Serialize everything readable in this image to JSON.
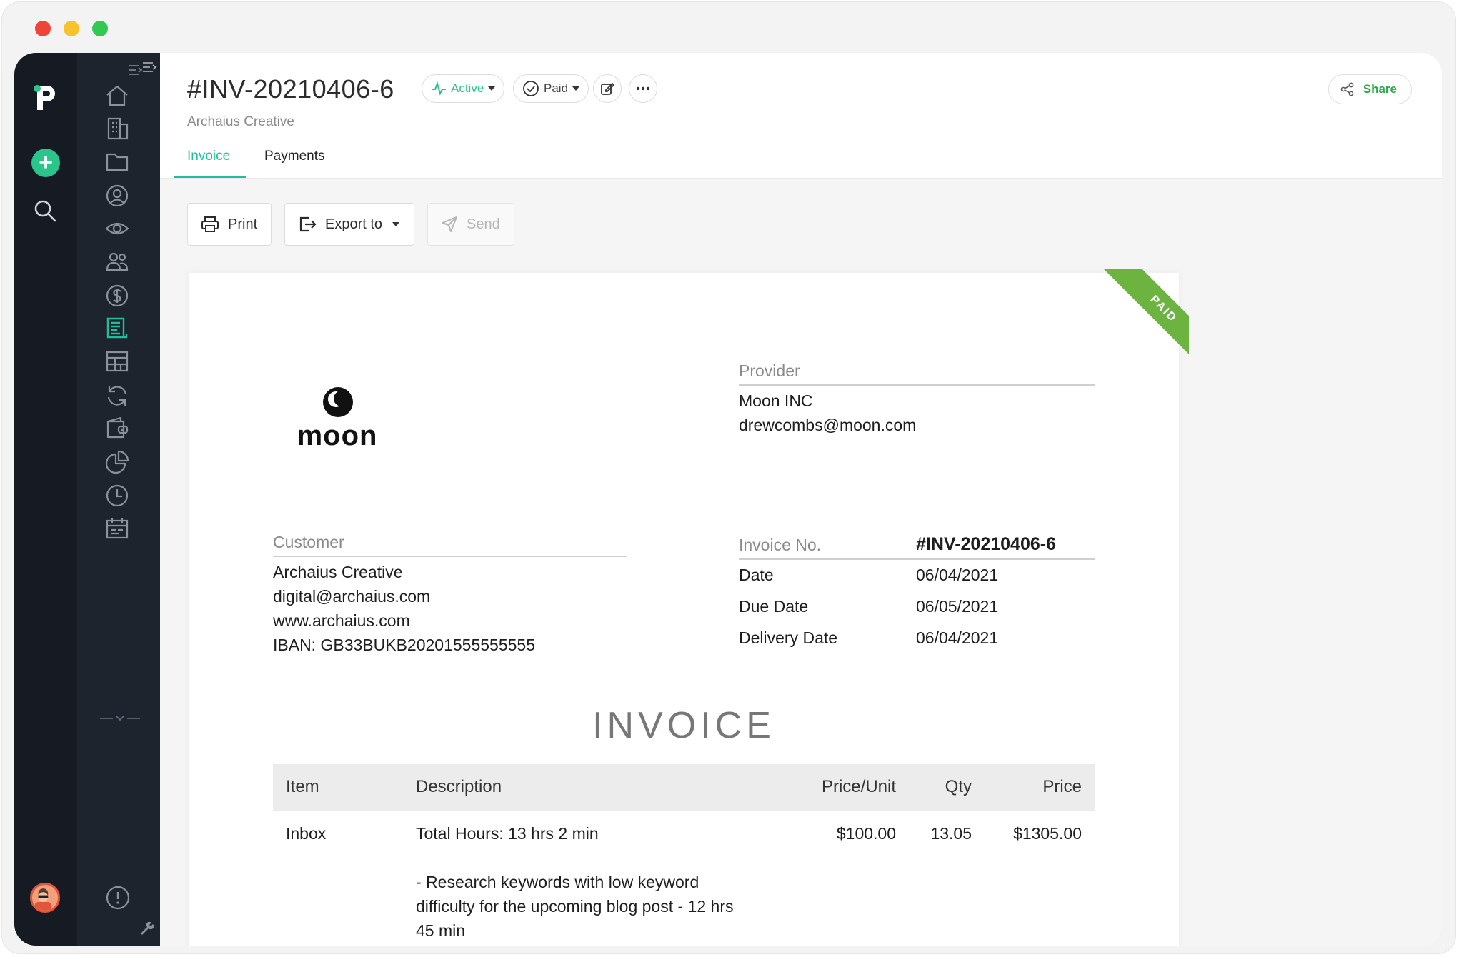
{
  "window": {
    "dots": [
      "#f0433a",
      "#f7c32b",
      "#2fc953"
    ]
  },
  "header": {
    "invoice_id": "#INV-20210406-6",
    "status_label": "Active",
    "payment_label": "Paid",
    "client_name": "Archaius Creative",
    "share_label": "Share",
    "tabs": [
      {
        "label": "Invoice",
        "active": true
      },
      {
        "label": "Payments",
        "active": false
      }
    ]
  },
  "toolbar": {
    "print_label": "Print",
    "export_label": "Export to",
    "send_label": "Send"
  },
  "document": {
    "ribbon": "PAID",
    "logo_text": "moon",
    "provider": {
      "label": "Provider",
      "name": "Moon INC",
      "email": "drewcombs@moon.com"
    },
    "customer": {
      "label": "Customer",
      "name": "Archaius Creative",
      "email": "digital@archaius.com",
      "website": "www.archaius.com",
      "iban": "IBAN: GB33BUKB20201555555555"
    },
    "meta": {
      "invoice_no_label": "Invoice No.",
      "invoice_no": "#INV-20210406-6",
      "date_label": "Date",
      "date": "06/04/2021",
      "due_label": "Due Date",
      "due": "06/05/2021",
      "delivery_label": "Delivery Date",
      "delivery": "06/04/2021"
    },
    "heading": "INVOICE",
    "table": {
      "headers": {
        "item": "Item",
        "description": "Description",
        "price_unit": "Price/Unit",
        "qty": "Qty",
        "price": "Price"
      },
      "rows": [
        {
          "item": "Inbox",
          "description": "Total Hours: 13 hrs 2 min",
          "details": [
            "- Research keywords with low keyword",
            "difficulty for the upcoming blog post - 12 hrs",
            "45 min"
          ],
          "price_unit": "$100.00",
          "qty": "13.05",
          "price": "$1305.00"
        }
      ]
    }
  },
  "sidebar": {
    "nav_icons": [
      "home-icon",
      "building-icon",
      "folder-icon",
      "user-circle-icon",
      "eye-icon",
      "people-icon",
      "dollar-icon",
      "invoice-icon",
      "table-icon",
      "refresh-icon",
      "wallet-icon",
      "pie-chart-icon",
      "clock-icon",
      "calendar-icon"
    ],
    "active_icon": "invoice-icon",
    "accent": "#1fbf9e"
  }
}
